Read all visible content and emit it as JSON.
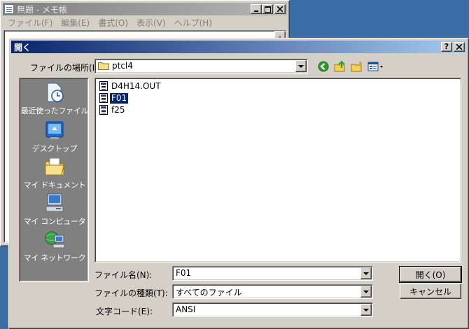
{
  "notepad": {
    "title": "無題 - メモ帳",
    "menu": [
      "ファイル(F)",
      "編集(E)",
      "書式(O)",
      "表示(V)",
      "ヘルプ(H)"
    ]
  },
  "dialog": {
    "title": "開く",
    "location_label": "ファイルの場所(I):",
    "location_value": "ptcl4",
    "places": [
      {
        "label": "最近使ったファイル",
        "icon": "recent-documents-icon"
      },
      {
        "label": "デスクトップ",
        "icon": "desktop-icon"
      },
      {
        "label": "マイ ドキュメント",
        "icon": "my-documents-icon"
      },
      {
        "label": "マイ コンピュータ",
        "icon": "my-computer-icon"
      },
      {
        "label": "マイ ネットワーク",
        "icon": "my-network-icon"
      }
    ],
    "files": [
      {
        "name": "D4H14.OUT",
        "selected": false
      },
      {
        "name": "F01",
        "selected": true
      },
      {
        "name": "f25",
        "selected": false
      }
    ],
    "filename_label": "ファイル名(N):",
    "filename_value": "F01",
    "filetype_label": "ファイルの種類(T):",
    "filetype_value": "すべてのファイル",
    "encoding_label": "文字コード(E):",
    "encoding_value": "ANSI",
    "open_button": "開く(O)",
    "cancel_button": "キャンセル"
  },
  "colors": {
    "desktop": "#3a6ea5",
    "active_title": "#0a246a",
    "selection": "#0a246a",
    "face": "#d4d0c8"
  }
}
